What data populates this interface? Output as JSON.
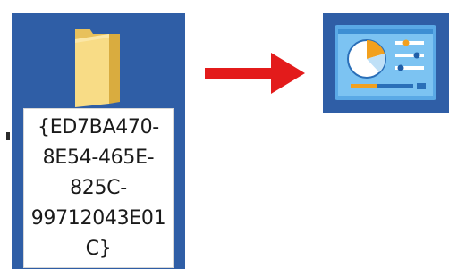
{
  "desktop_item": {
    "icon": "folder-icon",
    "label_lines": [
      "{ED7BA470-",
      "8E54-465E-",
      "825C-",
      "99712043E01",
      "C}"
    ]
  },
  "transition": {
    "icon": "arrow-right-icon",
    "color": "#e31b1b"
  },
  "result_item": {
    "icon": "control-panel-icon"
  },
  "colors": {
    "selection_blue": "#2f5ea6",
    "folder_yellow": "#f7d87a",
    "arrow_red": "#e31b1b"
  }
}
